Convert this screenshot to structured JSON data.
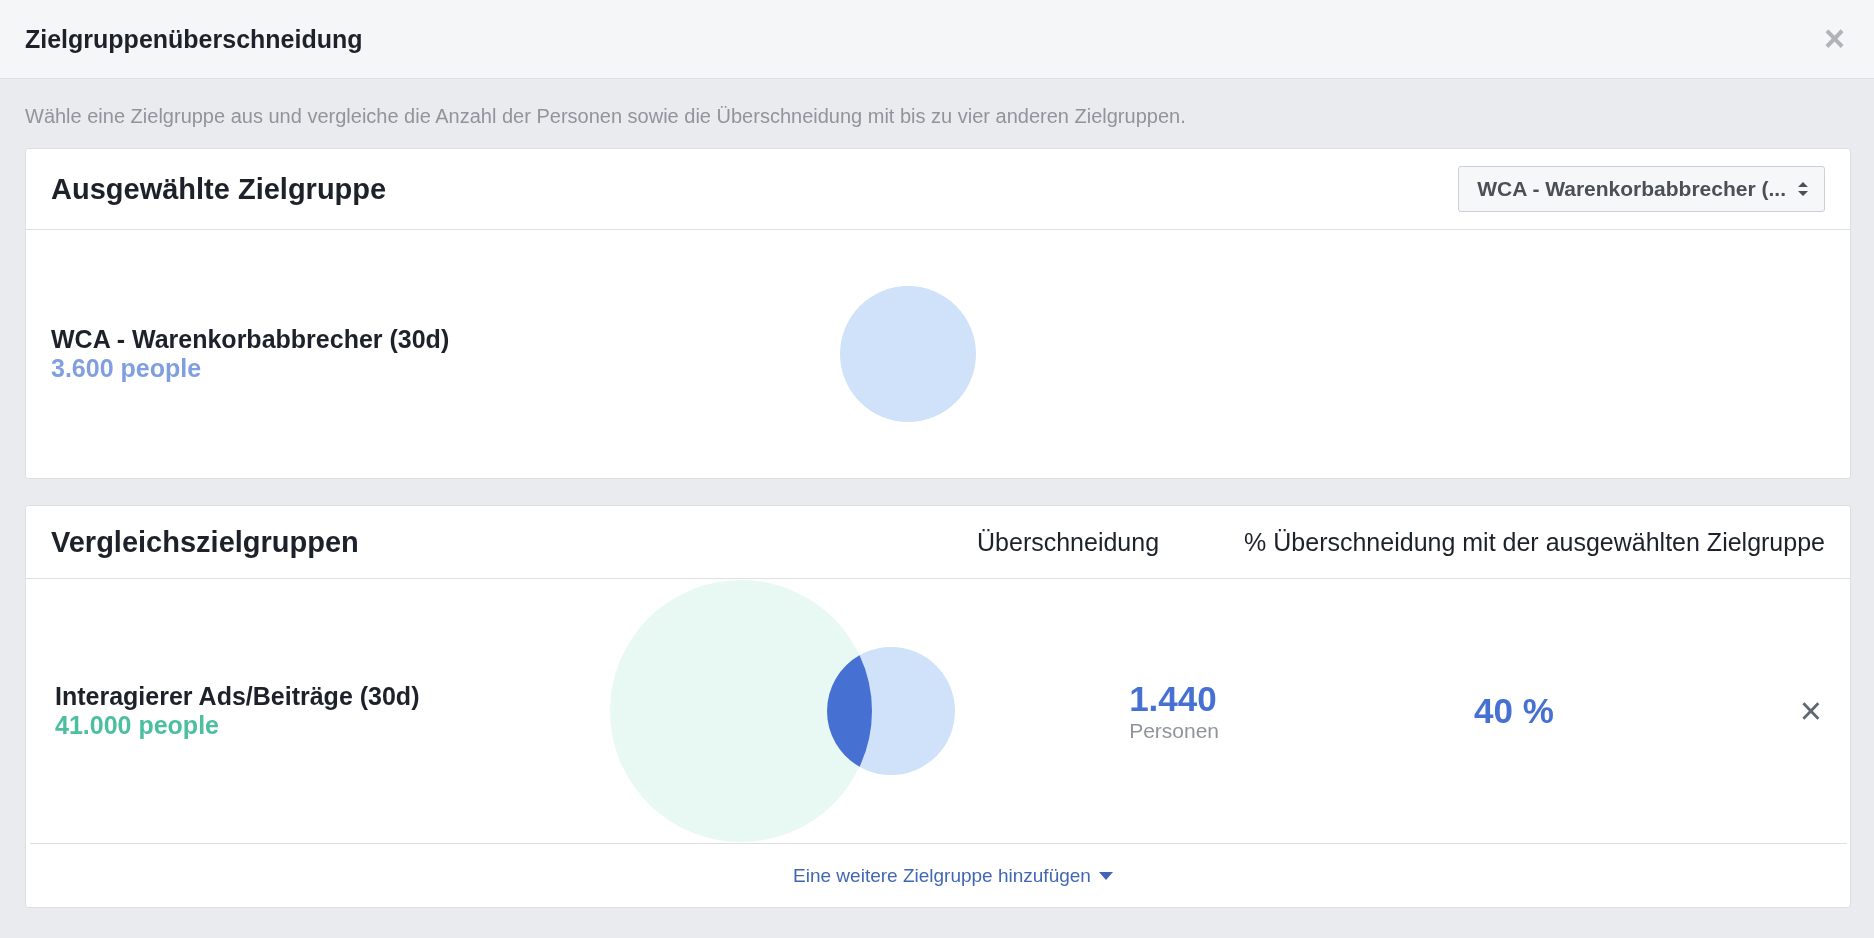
{
  "window": {
    "title": "Zielgruppenüberschneidung",
    "close": "×"
  },
  "description": "Wähle eine Zielgruppe aus und vergleiche die Anzahl der Personen sowie die Überschneidung mit bis zu vier anderen Zielgruppen.",
  "selected_audience": {
    "heading": "Ausgewählte Zielgruppe",
    "dropdown": "WCA - Warenkorbabbrecher (...",
    "name": "WCA - Warenkorbabbrecher (30d)",
    "people": "3.600 people",
    "color": "#7f9fe0"
  },
  "comparison": {
    "heading": "Vergleichszielgruppen",
    "columns": [
      "Überschneidung",
      "% Überschneidung mit der ausgewählten Zielgruppe"
    ],
    "rows": [
      {
        "name": "Interagierer Ads/Beiträge (30d)",
        "people": "41.000 people",
        "color": "#4cbfa0",
        "overlap": "1.440",
        "overlap_unit": "Personen",
        "percent": "40 %",
        "remove": "×"
      }
    ],
    "add_link": "Eine weitere Zielgruppe hinzufügen"
  }
}
